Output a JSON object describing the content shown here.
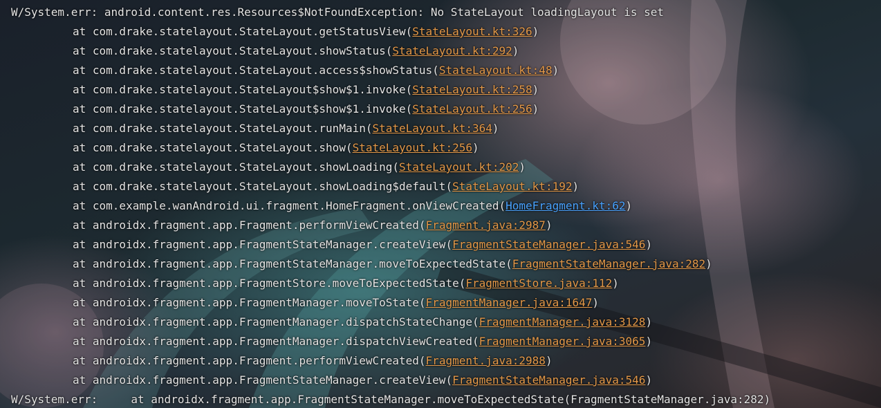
{
  "header": {
    "text": "W/System.err: android.content.res.Resources$NotFoundException: No StateLayout loadingLayout is set"
  },
  "frames": [
    {
      "prefix": "at com.drake.statelayout.StateLayout.getStatusView(",
      "link": "StateLayout.kt:326",
      "suffix": ")"
    },
    {
      "prefix": "at com.drake.statelayout.StateLayout.showStatus(",
      "link": "StateLayout.kt:292",
      "suffix": ")"
    },
    {
      "prefix": "at com.drake.statelayout.StateLayout.access$showStatus(",
      "link": "StateLayout.kt:48",
      "suffix": ")"
    },
    {
      "prefix": "at com.drake.statelayout.StateLayout$show$1.invoke(",
      "link": "StateLayout.kt:258",
      "suffix": ")"
    },
    {
      "prefix": "at com.drake.statelayout.StateLayout$show$1.invoke(",
      "link": "StateLayout.kt:256",
      "suffix": ")"
    },
    {
      "prefix": "at com.drake.statelayout.StateLayout.runMain(",
      "link": "StateLayout.kt:364",
      "suffix": ")"
    },
    {
      "prefix": "at com.drake.statelayout.StateLayout.show(",
      "link": "StateLayout.kt:256",
      "suffix": ")"
    },
    {
      "prefix": "at com.drake.statelayout.StateLayout.showLoading(",
      "link": "StateLayout.kt:202",
      "suffix": ")"
    },
    {
      "prefix": "at com.drake.statelayout.StateLayout.showLoading$default(",
      "link": "StateLayout.kt:192",
      "suffix": ")"
    },
    {
      "prefix": "at com.example.wanAndroid.ui.fragment.HomeFragment.onViewCreated(",
      "link": "HomeFragment.kt:62",
      "suffix": ")",
      "active": true
    },
    {
      "prefix": "at androidx.fragment.app.Fragment.performViewCreated(",
      "link": "Fragment.java:2987",
      "suffix": ")"
    },
    {
      "prefix": "at androidx.fragment.app.FragmentStateManager.createView(",
      "link": "FragmentStateManager.java:546",
      "suffix": ")"
    },
    {
      "prefix": "at androidx.fragment.app.FragmentStateManager.moveToExpectedState(",
      "link": "FragmentStateManager.java:282",
      "suffix": ")"
    },
    {
      "prefix": "at androidx.fragment.app.FragmentStore.moveToExpectedState(",
      "link": "FragmentStore.java:112",
      "suffix": ")"
    },
    {
      "prefix": "at androidx.fragment.app.FragmentManager.moveToState(",
      "link": "FragmentManager.java:1647",
      "suffix": ")"
    },
    {
      "prefix": "at androidx.fragment.app.FragmentManager.dispatchStateChange(",
      "link": "FragmentManager.java:3128",
      "suffix": ")"
    },
    {
      "prefix": "at androidx.fragment.app.FragmentManager.dispatchViewCreated(",
      "link": "FragmentManager.java:3065",
      "suffix": ")"
    },
    {
      "prefix": "at androidx.fragment.app.Fragment.performViewCreated(",
      "link": "Fragment.java:2988",
      "suffix": ")"
    },
    {
      "prefix": "at androidx.fragment.app.FragmentStateManager.createView(",
      "link": "FragmentStateManager.java:546",
      "suffix": ")"
    }
  ],
  "footer": {
    "text": "W/System.err:     at androidx.fragment.app.FragmentStateManager.moveToExpectedState(FragmentStateManager.java:282)"
  },
  "colors": {
    "text": "#e6e6e6",
    "link": "#e59a4a",
    "link_active": "#4aa3ff"
  }
}
